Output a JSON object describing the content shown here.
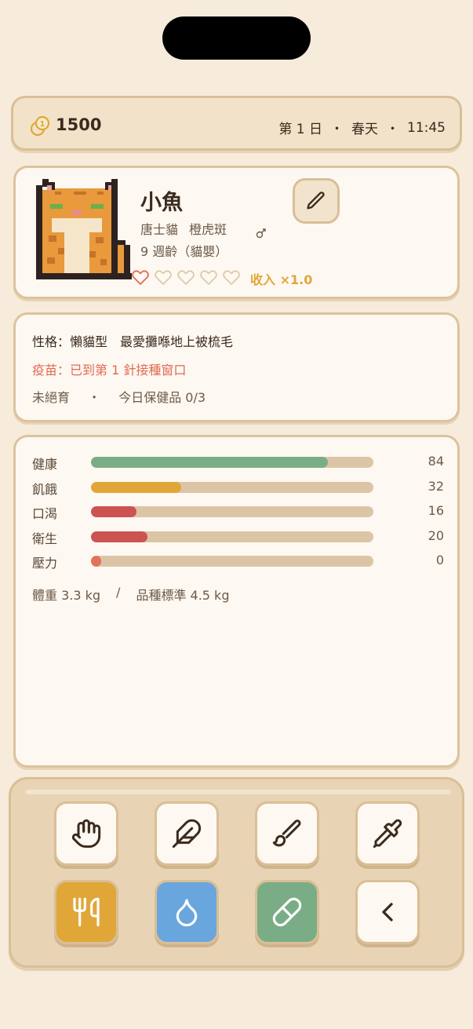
{
  "header": {
    "coins": "1500",
    "day": "第 1 日",
    "season": "春天",
    "time": "11:45",
    "separator": "・"
  },
  "pet": {
    "name": "小魚",
    "breed": "唐士貓",
    "pattern": "橙虎斑",
    "age": "9 週齡（貓嬰）",
    "hearts_filled": 1,
    "hearts_total": 5,
    "income": "收入 ×1.0"
  },
  "info": {
    "personality": "性格：懶貓型　最愛攤喺地上被梳毛",
    "vaccine": "疫苗：已到第 1 針接種窗口",
    "neutered": "未絕育",
    "separator": "・",
    "supplements": "今日保健品 0/3"
  },
  "stats": [
    {
      "label": "健康",
      "value": 84,
      "color": "#7aad86"
    },
    {
      "label": "飢餓",
      "value": 32,
      "color": "#e0a738"
    },
    {
      "label": "口渴",
      "value": 16,
      "color": "#cd5252"
    },
    {
      "label": "衛生",
      "value": 20,
      "color": "#cd5252"
    },
    {
      "label": "壓力",
      "value": 0,
      "color": "#e0735a"
    }
  ],
  "weight": {
    "current": "體重 3.3 kg",
    "separator": "/",
    "standard": "品種標準 4.5 kg"
  },
  "actions": [
    {
      "icon": "hand-icon"
    },
    {
      "icon": "feather-icon"
    },
    {
      "icon": "brush-icon"
    },
    {
      "icon": "shovel-icon"
    },
    {
      "icon": "fork-knife-icon"
    },
    {
      "icon": "water-drop-icon"
    },
    {
      "icon": "pill-icon"
    },
    {
      "icon": "back-chevron-icon"
    }
  ]
}
